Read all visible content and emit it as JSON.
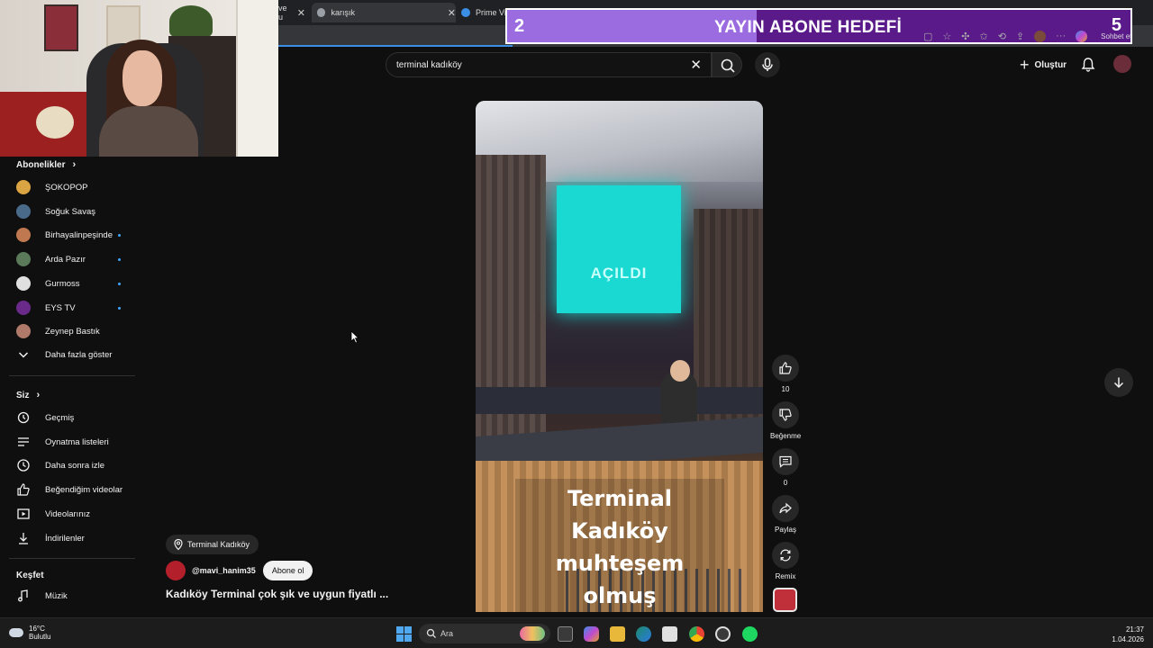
{
  "tabs": [
    {
      "label": "ve u"
    },
    {
      "label": "karışık"
    },
    {
      "label": "Prime Vid"
    }
  ],
  "goal_overlay": {
    "current": "2",
    "title": "YAYIN ABONE HEDEFİ",
    "target": "5",
    "progress_fraction": 0.4
  },
  "browser_tools": {
    "copilot_label": "Sohbet et"
  },
  "header": {
    "search_query": "terminal kadıköy",
    "create_label": "Oluştur"
  },
  "sidebar": {
    "subscriptions_heading": "Abonelikler",
    "subscriptions": [
      {
        "name": "ŞOKOPOP",
        "new": false,
        "color": "#d9a441"
      },
      {
        "name": "Soğuk Savaş",
        "new": false,
        "color": "#4a6a8a"
      },
      {
        "name": "Birhayalinpeşinde",
        "new": true,
        "color": "#c07850"
      },
      {
        "name": "Arda Pazır",
        "new": true,
        "color": "#5a7a5a"
      },
      {
        "name": "Gurmoss",
        "new": true,
        "color": "#e0e0e0"
      },
      {
        "name": "EYS TV",
        "new": true,
        "color": "#6a2a8a"
      },
      {
        "name": "Zeynep Bastık",
        "new": false,
        "color": "#b07a6a"
      }
    ],
    "show_more_label": "Daha fazla göster",
    "you_heading": "Siz",
    "you_items": [
      {
        "label": "Geçmiş",
        "icon": "history-icon"
      },
      {
        "label": "Oynatma listeleri",
        "icon": "playlists-icon"
      },
      {
        "label": "Daha sonra izle",
        "icon": "watch-later-icon"
      },
      {
        "label": "Beğendiğim videolar",
        "icon": "thumb-up-icon"
      },
      {
        "label": "Videolarınız",
        "icon": "your-videos-icon"
      },
      {
        "label": "İndirilenler",
        "icon": "download-icon"
      }
    ],
    "explore_heading": "Keşfet",
    "explore_items": [
      {
        "label": "Müzik",
        "icon": "music-icon"
      }
    ]
  },
  "video": {
    "screen_text": "AÇILDI",
    "caption_line1": "Terminal Kadıköy",
    "caption_line2": "muhteşem olmuş",
    "location": "Terminal Kadıköy",
    "channel": "@mavi_hanim35",
    "subscribe_label": "Abone ol",
    "title": "Kadıköy Terminal çok şık ve uygun fiyatlı ..."
  },
  "actions": {
    "like_count": "10",
    "dislike_label": "Beğenme",
    "comment_count": "0",
    "share_label": "Paylaş",
    "remix_label": "Remix"
  },
  "taskbar": {
    "temperature": "16°C",
    "weather": "Bulutlu",
    "search_label": "Ara",
    "time": "21:37",
    "date": "1.04.2026"
  }
}
